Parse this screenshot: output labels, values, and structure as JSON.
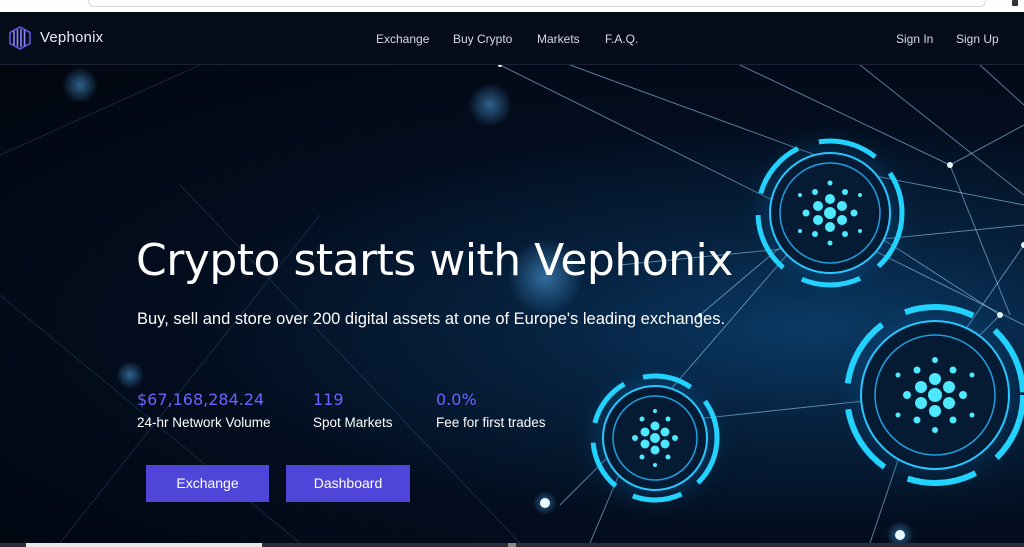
{
  "brand": {
    "name": "Vephonix",
    "logo_icon": "vephonix-logo-icon"
  },
  "nav": {
    "links": [
      "Exchange",
      "Buy Crypto",
      "Markets",
      "F.A.Q."
    ],
    "signin": "Sign In",
    "signup": "Sign Up"
  },
  "hero": {
    "title": "Crypto starts with Vephonix",
    "subtitle": "Buy, sell and store over 200 digital assets at one of Europe's leading exchanges.",
    "stats": [
      {
        "value": "$67,168,284.24",
        "label": "24-hr Network Volume"
      },
      {
        "value": "119",
        "label": "Spot Markets"
      },
      {
        "value": "0.0%",
        "label": "Fee for first trades"
      }
    ],
    "buttons": {
      "exchange": "Exchange",
      "dashboard": "Dashboard"
    }
  },
  "colors": {
    "navbar_bg": "#060b1a",
    "accent": "#4f46d9",
    "stat_value": "#6c63ff",
    "glow": "#22d3ff"
  }
}
